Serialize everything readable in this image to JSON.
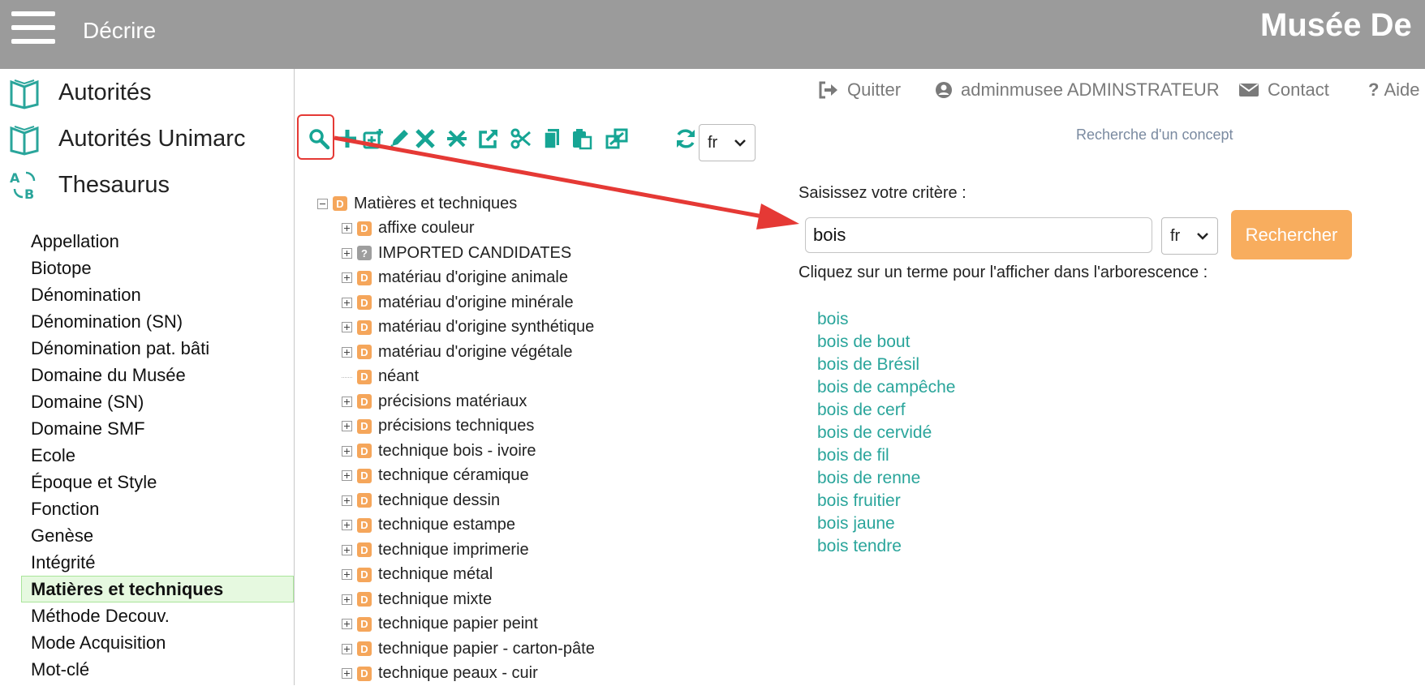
{
  "topbar": {
    "app_title": "Décrire",
    "museum_title": "Musée De"
  },
  "sidebar": {
    "main_items": [
      {
        "label": "Autorités",
        "icon": "book-icon"
      },
      {
        "label": "Autorités Unimarc",
        "icon": "book-icon"
      },
      {
        "label": "Thesaurus",
        "icon": "thesaurus-icon"
      }
    ],
    "thesaurus_items": [
      "Appellation",
      "Biotope",
      "Dénomination",
      "Dénomination (SN)",
      "Dénomination pat. bâti",
      "Domaine du Musée",
      "Domaine (SN)",
      "Domaine SMF",
      "Ecole",
      "Époque et Style",
      "Fonction",
      "Genèse",
      "Intégrité",
      "Matières et techniques",
      "Méthode Decouv.",
      "Mode Acquisition",
      "Mot-clé"
    ],
    "active_item": "Matières et techniques"
  },
  "header_links": {
    "quit": "Quitter",
    "user": "adminmusee ADMINSTRATEUR",
    "contact": "Contact",
    "help": "Aide"
  },
  "toolbar": {
    "icons": [
      "search-icon",
      "add-icon",
      "add-child-icon",
      "edit-icon",
      "delete-icon",
      "delete-all-icon",
      "external-link-icon",
      "cut-icon",
      "copy-icon",
      "paste-icon",
      "merge-icon"
    ],
    "refresh_icon": "refresh-icon",
    "lang": "fr"
  },
  "search_panel": {
    "title": "Recherche d'un concept",
    "criteria_label": "Saisissez votre critère :",
    "input_value": "bois",
    "lang": "fr",
    "button_label": "Rechercher",
    "click_label": "Cliquez sur un terme pour l'afficher dans l'arborescence :",
    "results": [
      "bois",
      "bois de bout",
      "bois de Brésil",
      "bois de campêche",
      "bois de cerf",
      "bois de cervidé",
      "bois de fil",
      "bois de renne",
      "bois fruitier",
      "bois jaune",
      "bois tendre"
    ]
  },
  "tree": {
    "root": {
      "label": "Matières et techniques",
      "badge": "D"
    },
    "children": [
      {
        "label": "affixe couleur",
        "badge": "D",
        "expandable": true
      },
      {
        "label": "IMPORTED CANDIDATES",
        "badge": "?",
        "expandable": true
      },
      {
        "label": "matériau d'origine animale",
        "badge": "D",
        "expandable": true
      },
      {
        "label": "matériau d'origine minérale",
        "badge": "D",
        "expandable": true
      },
      {
        "label": "matériau d'origine synthétique",
        "badge": "D",
        "expandable": true
      },
      {
        "label": "matériau d'origine végétale",
        "badge": "D",
        "expandable": true
      },
      {
        "label": "néant",
        "badge": "D",
        "expandable": false
      },
      {
        "label": "précisions matériaux",
        "badge": "D",
        "expandable": true
      },
      {
        "label": "précisions techniques",
        "badge": "D",
        "expandable": true
      },
      {
        "label": "technique bois - ivoire",
        "badge": "D",
        "expandable": true
      },
      {
        "label": "technique céramique",
        "badge": "D",
        "expandable": true
      },
      {
        "label": "technique dessin",
        "badge": "D",
        "expandable": true
      },
      {
        "label": "technique estampe",
        "badge": "D",
        "expandable": true
      },
      {
        "label": "technique imprimerie",
        "badge": "D",
        "expandable": true
      },
      {
        "label": "technique métal",
        "badge": "D",
        "expandable": true
      },
      {
        "label": "technique mixte",
        "badge": "D",
        "expandable": true
      },
      {
        "label": "technique papier peint",
        "badge": "D",
        "expandable": true
      },
      {
        "label": "technique papier - carton-pâte",
        "badge": "D",
        "expandable": true
      },
      {
        "label": "technique peaux - cuir",
        "badge": "D",
        "expandable": true
      }
    ]
  },
  "colors": {
    "topbar": "#9b9b9b",
    "accent_orange": "#f8ad5e",
    "link_teal": "#2aa59b",
    "toolbar_teal": "#16a594",
    "annotation_red": "#e53935"
  }
}
